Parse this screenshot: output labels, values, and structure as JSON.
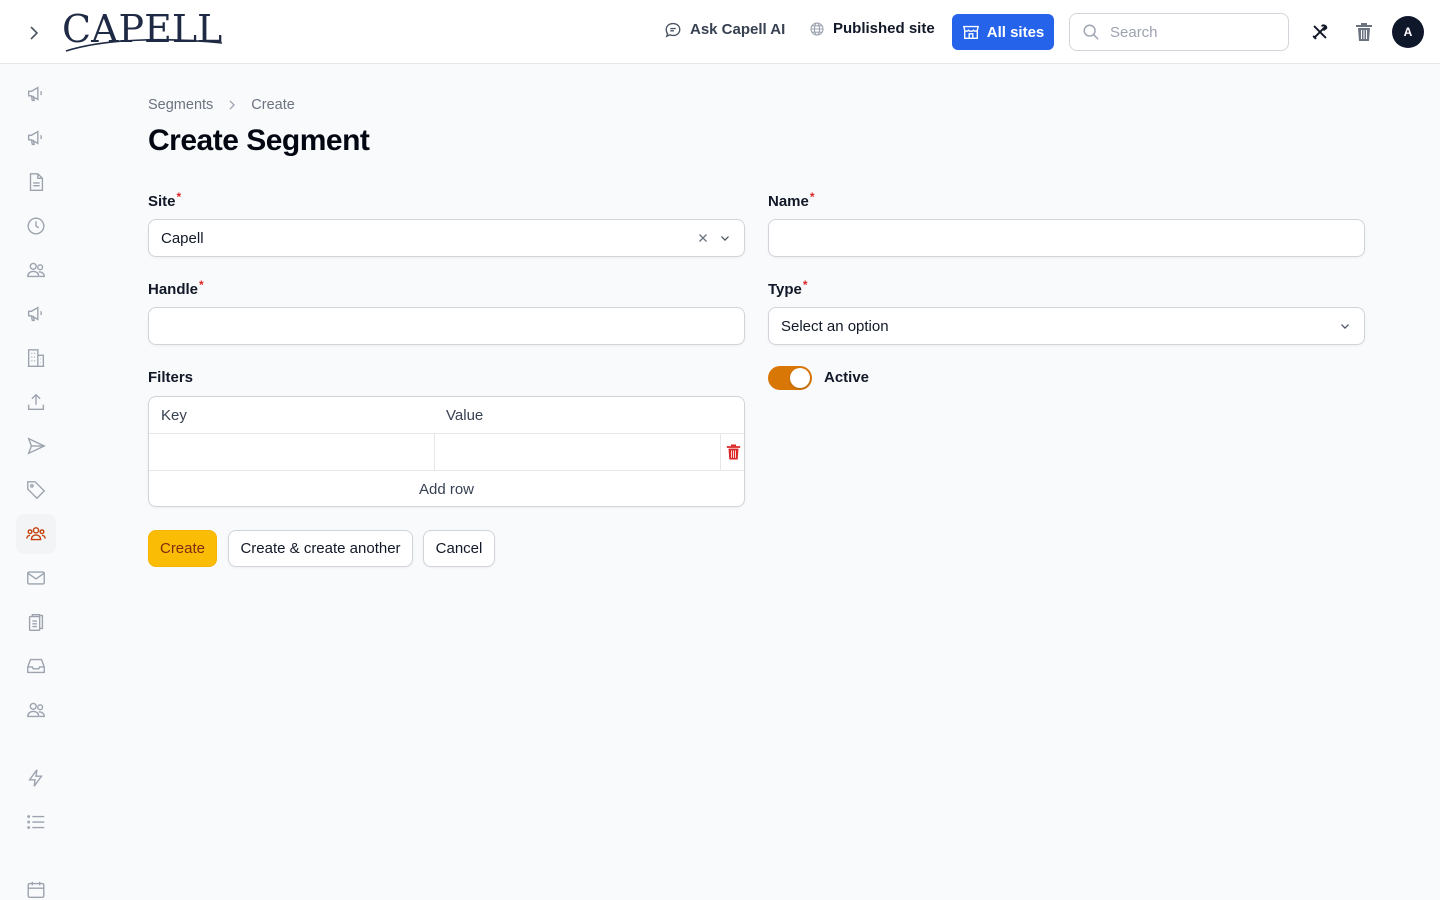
{
  "brand": {
    "logo_text": "CAPELL"
  },
  "header": {
    "ask_ai_label": "Ask Capell AI",
    "published_label": "Published site",
    "all_sites_label": "All sites",
    "search_placeholder": "Search",
    "avatar_initial": "A"
  },
  "colors": {
    "primary_button": "#fbbc05",
    "all_sites_button": "#2563eb",
    "toggle_on": "#d97706",
    "active_nav": "#c2410c",
    "required_marker": "#dc2626",
    "delete_icon": "#dc2626"
  },
  "sidebar": {
    "items": [
      {
        "icon": "megaphone-icon",
        "active": false
      },
      {
        "icon": "megaphone-icon",
        "active": false
      },
      {
        "icon": "document-icon",
        "active": false
      },
      {
        "icon": "clock-icon",
        "active": false
      },
      {
        "icon": "users-icon",
        "active": false
      },
      {
        "icon": "megaphone-icon",
        "active": false
      },
      {
        "icon": "building-icon",
        "active": false
      },
      {
        "icon": "upload-icon",
        "active": false
      },
      {
        "icon": "send-icon",
        "active": false
      },
      {
        "icon": "tag-icon",
        "active": false
      },
      {
        "icon": "user-group-icon",
        "active": true
      },
      {
        "icon": "envelope-icon",
        "active": false
      },
      {
        "icon": "clipboard-icon",
        "active": false
      },
      {
        "icon": "inbox-icon",
        "active": false
      },
      {
        "icon": "users-icon",
        "active": false
      },
      {
        "icon": "bolt-icon",
        "active": false
      },
      {
        "icon": "list-icon",
        "active": false
      },
      {
        "icon": "calendar-icon",
        "active": false
      }
    ]
  },
  "breadcrumb": {
    "parent": "Segments",
    "current": "Create"
  },
  "page": {
    "title": "Create Segment"
  },
  "form": {
    "site": {
      "label": "Site",
      "required_mark": "*",
      "value": "Capell"
    },
    "name": {
      "label": "Name",
      "required_mark": "*",
      "value": ""
    },
    "handle": {
      "label": "Handle",
      "required_mark": "*",
      "value": ""
    },
    "type": {
      "label": "Type",
      "required_mark": "*",
      "placeholder": "Select an option"
    },
    "active": {
      "label": "Active",
      "on": true
    },
    "filters": {
      "label": "Filters",
      "columns": [
        "Key",
        "Value"
      ],
      "rows": [
        {
          "key": "",
          "value": ""
        }
      ],
      "add_row_label": "Add row"
    }
  },
  "actions": {
    "create": "Create",
    "create_another": "Create & create another",
    "cancel": "Cancel"
  }
}
